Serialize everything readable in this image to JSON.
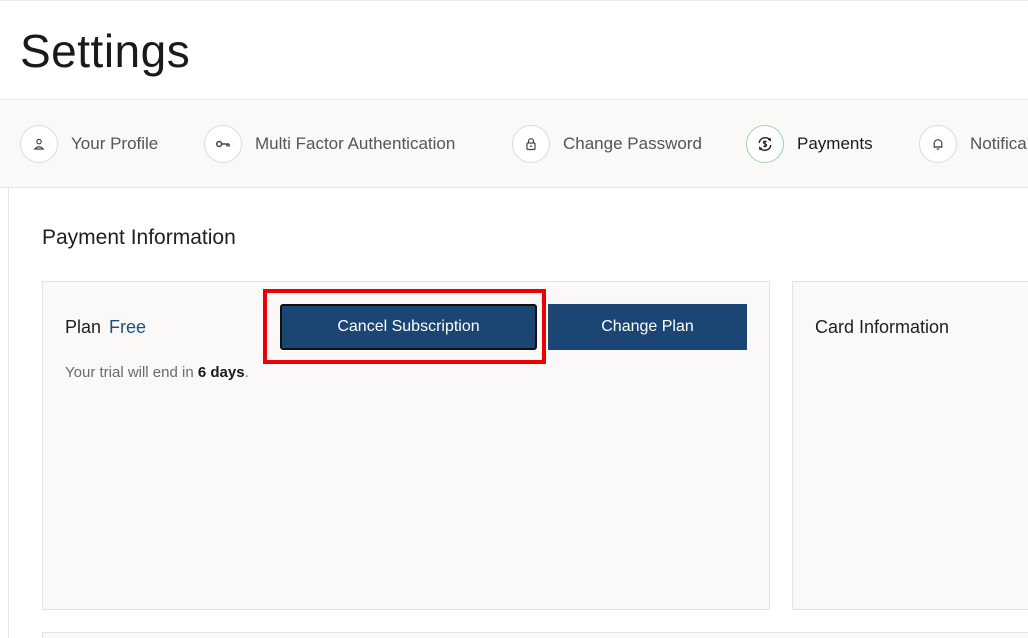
{
  "page": {
    "title": "Settings"
  },
  "tabs": [
    {
      "label": "Your Profile",
      "icon": "user-icon",
      "active": false
    },
    {
      "label": "Multi Factor Authentication",
      "icon": "key-icon",
      "active": false
    },
    {
      "label": "Change Password",
      "icon": "lock-icon",
      "active": false
    },
    {
      "label": "Payments",
      "icon": "payment-cycle-icon",
      "active": true
    },
    {
      "label": "Notifica",
      "icon": "bell-icon",
      "active": false
    }
  ],
  "payment": {
    "section_title": "Payment Information",
    "plan_label": "Plan",
    "plan_value": "Free",
    "trial_prefix": "Your trial will end in ",
    "trial_days": "6 days",
    "trial_suffix": ".",
    "cancel_button": "Cancel Subscription",
    "change_button": "Change Plan",
    "card_title": "Card Information"
  },
  "colors": {
    "primary_button": "#1b4674",
    "plan_value": "#1f4f82",
    "highlight": "#ee0000",
    "active_tab_ring": "#9fd3a8"
  }
}
